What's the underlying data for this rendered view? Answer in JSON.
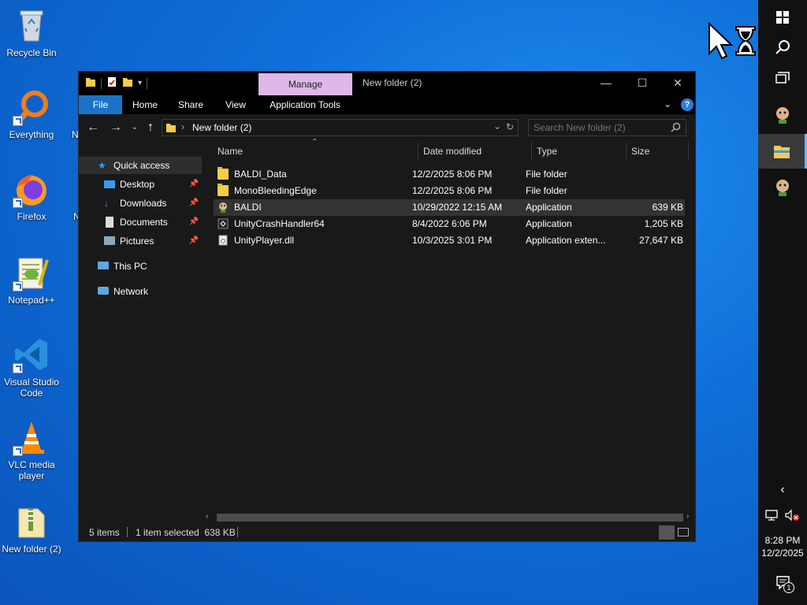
{
  "desktop": {
    "icons": [
      {
        "label": "Recycle Bin",
        "icon": "recycle-bin-icon"
      },
      {
        "label": "Everything",
        "icon": "everything-search-icon"
      },
      {
        "label": "Firefox",
        "icon": "firefox-icon"
      },
      {
        "label": "Notepad++",
        "icon": "notepadpp-icon"
      },
      {
        "label": "Visual Studio Code",
        "icon": "vscode-icon"
      },
      {
        "label": "VLC media player",
        "icon": "vlc-icon"
      },
      {
        "label": "New folder (2)",
        "icon": "zip-folder-icon"
      }
    ],
    "partial_labels": [
      "N",
      "N"
    ]
  },
  "taskbar": {
    "buttons": [
      "start",
      "search",
      "task-view",
      "baldi-app",
      "file-explorer",
      "baldi-app-2"
    ],
    "clock": {
      "time": "8:28 PM",
      "date": "12/2/2025"
    },
    "notification_count": "1"
  },
  "window": {
    "title": "New folder (2)",
    "contextual_tab": "Manage",
    "ribbon_tabs": [
      "File",
      "Home",
      "Share",
      "View",
      "Application Tools"
    ],
    "address": "New folder (2)",
    "search_placeholder": "Search New folder (2)",
    "nav": {
      "quick_access": "Quick access",
      "pinned": [
        "Desktop",
        "Downloads",
        "Documents",
        "Pictures"
      ],
      "this_pc": "This PC",
      "network": "Network"
    },
    "columns": {
      "name": "Name",
      "date": "Date modified",
      "type": "Type",
      "size": "Size"
    },
    "files": [
      {
        "name": "BALDI_Data",
        "date": "12/2/2025 8:06 PM",
        "type": "File folder",
        "size": "",
        "icon": "folder-icon"
      },
      {
        "name": "MonoBleedingEdge",
        "date": "12/2/2025 8:06 PM",
        "type": "File folder",
        "size": "",
        "icon": "folder-icon"
      },
      {
        "name": "BALDI",
        "date": "10/29/2022 12:15 AM",
        "type": "Application",
        "size": "639 KB",
        "icon": "baldi-app-icon",
        "selected": true
      },
      {
        "name": "UnityCrashHandler64",
        "date": "8/4/2022 6:06 PM",
        "type": "Application",
        "size": "1,205 KB",
        "icon": "unity-icon"
      },
      {
        "name": "UnityPlayer.dll",
        "date": "10/3/2025 3:01 PM",
        "type": "Application exten...",
        "size": "27,647 KB",
        "icon": "dll-icon"
      }
    ],
    "status": {
      "items": "5 items",
      "selected": "1 item selected  638 KB"
    }
  }
}
